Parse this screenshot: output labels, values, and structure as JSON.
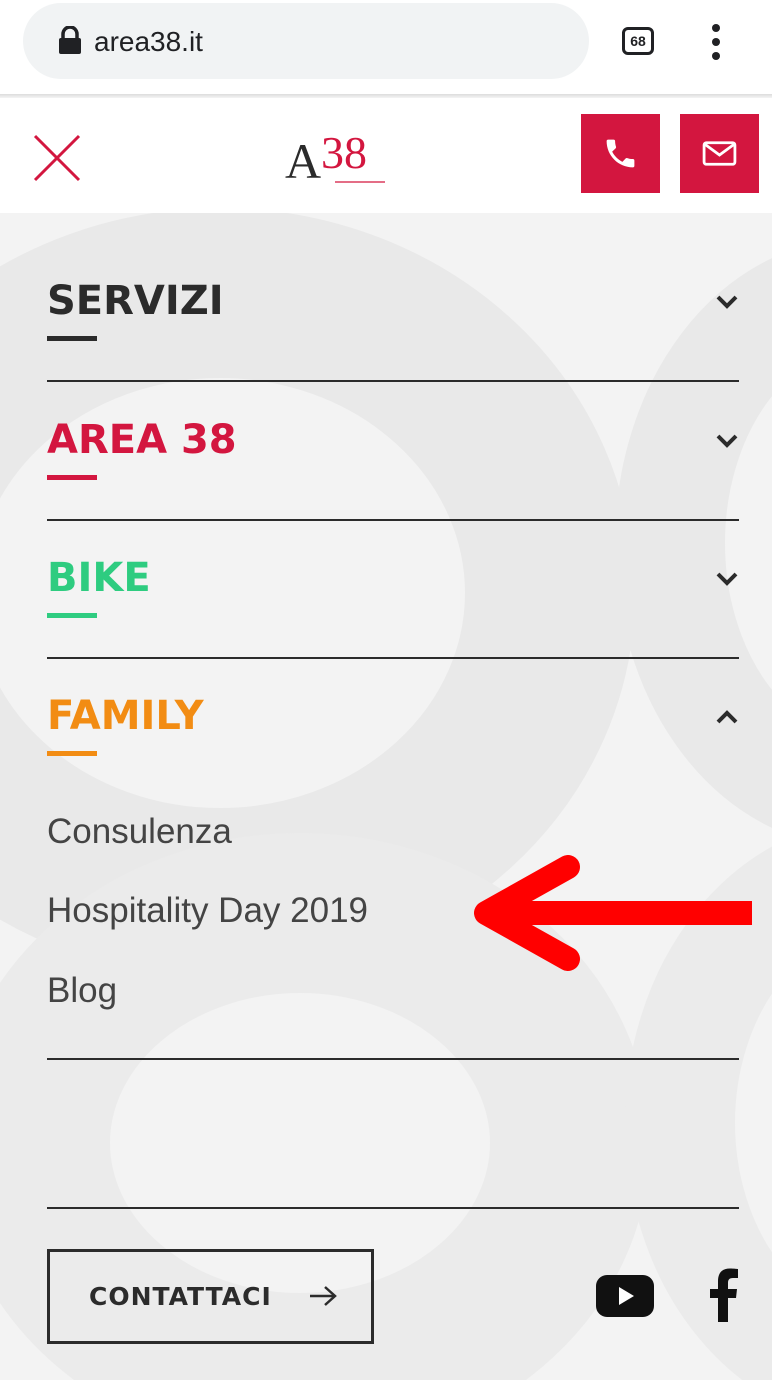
{
  "browser": {
    "url": "area38.it",
    "tabs_count": "68",
    "icons": [
      "lock-icon",
      "tabs-icon",
      "kebab-menu-icon"
    ]
  },
  "header": {
    "logo": "A38",
    "icons": [
      "close-icon",
      "phone-icon",
      "mail-icon"
    ],
    "accent_color": "#d3163f"
  },
  "menu": {
    "sections": [
      {
        "label": "SERVIZI",
        "color": "#2b2b2b",
        "expanded": false
      },
      {
        "label": "AREA 38",
        "color": "#d3163f",
        "expanded": false
      },
      {
        "label": "BIKE",
        "color": "#2ecc80",
        "expanded": false
      },
      {
        "label": "FAMILY",
        "color": "#f28c13",
        "expanded": true,
        "items": [
          "Consulenza",
          "Hospitality Day 2019",
          "Blog"
        ]
      }
    ]
  },
  "footer": {
    "contact_label": "CONTATTACI",
    "social_icons": [
      "youtube-icon",
      "facebook-icon"
    ]
  },
  "annotation": {
    "arrow_color": "#ff0000",
    "points_to": "Hospitality Day 2019"
  }
}
